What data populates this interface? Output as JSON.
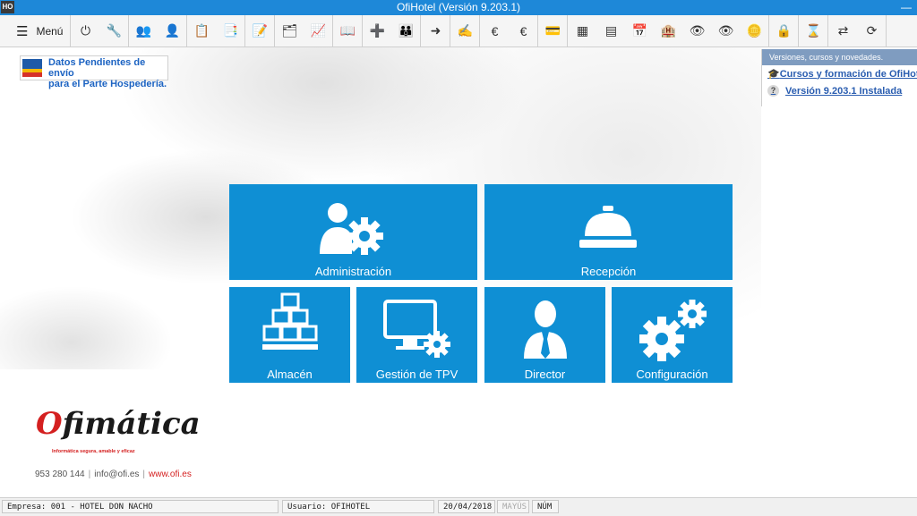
{
  "window": {
    "title": "OfiHotel (Versión 9.203.1)",
    "app_icon_text": "HO",
    "minimize_label": "—"
  },
  "toolbar": {
    "menu_label": "Menú",
    "groups": [
      [
        {
          "icon": "power-icon",
          "glyph": "⏻"
        },
        {
          "icon": "tools-icon",
          "glyph": "🔧"
        }
      ],
      [
        {
          "icon": "add-clients-icon",
          "glyph": "👥"
        },
        {
          "icon": "add-user-icon",
          "glyph": "👤"
        }
      ],
      [
        {
          "icon": "documents-icon",
          "glyph": "📋"
        },
        {
          "icon": "document-transfer-icon",
          "glyph": "📑"
        }
      ],
      [
        {
          "icon": "edit-document-icon",
          "glyph": "📝"
        }
      ],
      [
        {
          "icon": "stack-edit-icon",
          "glyph": "🗂"
        },
        {
          "icon": "chart-icon",
          "glyph": "📈"
        }
      ],
      [
        {
          "icon": "book-icon",
          "glyph": "📖"
        }
      ],
      [
        {
          "icon": "checkin-icon",
          "glyph": "➕"
        },
        {
          "icon": "group-guests-icon",
          "glyph": "👪"
        }
      ],
      [
        {
          "icon": "checkout-icon",
          "glyph": "➜"
        }
      ],
      [
        {
          "icon": "sign-document-icon",
          "glyph": "✍"
        }
      ],
      [
        {
          "icon": "euro-down-icon",
          "glyph": "€"
        },
        {
          "icon": "euro-up-icon",
          "glyph": "€"
        }
      ],
      [
        {
          "icon": "card-check-icon",
          "glyph": "💳"
        }
      ],
      [
        {
          "icon": "table-icon",
          "glyph": "▦"
        },
        {
          "icon": "table-edit-icon",
          "glyph": "▤"
        },
        {
          "icon": "calendar-icon",
          "glyph": "📅"
        },
        {
          "icon": "building-lock-icon",
          "glyph": "🏨"
        },
        {
          "icon": "view-documents-icon",
          "glyph": "👁"
        },
        {
          "icon": "view-coins-icon",
          "glyph": "👁"
        },
        {
          "icon": "coins-icon",
          "glyph": "🪙"
        }
      ],
      [
        {
          "icon": "lock-icon",
          "glyph": "🔒"
        }
      ],
      [
        {
          "icon": "hourglass-icon",
          "glyph": "⌛"
        }
      ],
      [
        {
          "icon": "doc-transfer-icon",
          "glyph": "⇄"
        },
        {
          "icon": "doc-sync-icon",
          "glyph": "⟳"
        }
      ]
    ]
  },
  "notice": {
    "line1": "Datos Pendientes de envío",
    "line2": "para el Parte Hospedería."
  },
  "news": {
    "header": "Versiones, cursos y novedades.",
    "items": [
      {
        "label": "Cursos y formación de OfiHotel"
      },
      {
        "label": "Versión 9.203.1 Instalada"
      }
    ]
  },
  "modules": {
    "administracion": "Administración",
    "recepcion": "Recepción",
    "almacen": "Almacén",
    "tpv": "Gestión de TPV",
    "director": "Director",
    "configuracion": "Configuración",
    "tile_color": "#0f8fd4"
  },
  "logo": {
    "brand_o": "O",
    "brand_rest": "fimática",
    "tagline": "Informática segura, amable y eficaz"
  },
  "contact": {
    "phone": "953 280 144",
    "email": "info@ofi.es",
    "web": "www.ofi.es"
  },
  "statusbar": {
    "empresa": "Empresa: 001 - HOTEL DON NACHO",
    "usuario": "Usuario: OFIHOTEL",
    "fecha": "20/04/2018",
    "mayus": "MAYÚS",
    "num": "NÚM"
  }
}
